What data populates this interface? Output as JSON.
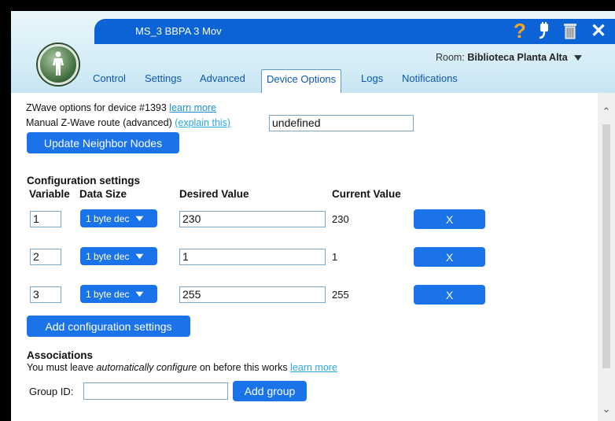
{
  "window": {
    "title": "MS_3 BBPA 3 Mov",
    "room_label": "Room:",
    "room_value": "Biblioteca Planta Alta",
    "icons": [
      "help-icon",
      "plug-icon",
      "trash-icon",
      "close-icon"
    ],
    "accent_color": "#1a73e8"
  },
  "tabs": [
    {
      "label": "Control",
      "active": false
    },
    {
      "label": "Settings",
      "active": false
    },
    {
      "label": "Advanced",
      "active": false
    },
    {
      "label": "Device Options",
      "active": true
    },
    {
      "label": "Logs",
      "active": false
    },
    {
      "label": "Notifications",
      "active": false
    }
  ],
  "zwave": {
    "options_text": "ZWave options for device #1393",
    "learn_more": "learn more",
    "route_label": "Manual Z-Wave route (advanced)",
    "explain_link": "(explain this)",
    "route_value": "undefined",
    "update_button": "Update Neighbor Nodes"
  },
  "config": {
    "section_title": "Configuration settings",
    "headers": {
      "variable": "Variable",
      "data_size": "Data Size",
      "desired": "Desired Value",
      "current": "Current Value"
    },
    "rows": [
      {
        "variable": "1",
        "data_size": "1 byte dec",
        "desired": "230",
        "current": "230",
        "remove": "X"
      },
      {
        "variable": "2",
        "data_size": "1 byte dec",
        "desired": "1",
        "current": "1",
        "remove": "X"
      },
      {
        "variable": "3",
        "data_size": "1 byte dec",
        "desired": "255",
        "current": "255",
        "remove": "X"
      }
    ],
    "add_button": "Add configuration settings"
  },
  "associations": {
    "title": "Associations",
    "note_before": "You must leave ",
    "note_em": "automatically configure",
    "note_after": " on before this works ",
    "learn_more": "learn more",
    "group_label": "Group ID:",
    "group_value": "",
    "add_group": "Add group"
  }
}
